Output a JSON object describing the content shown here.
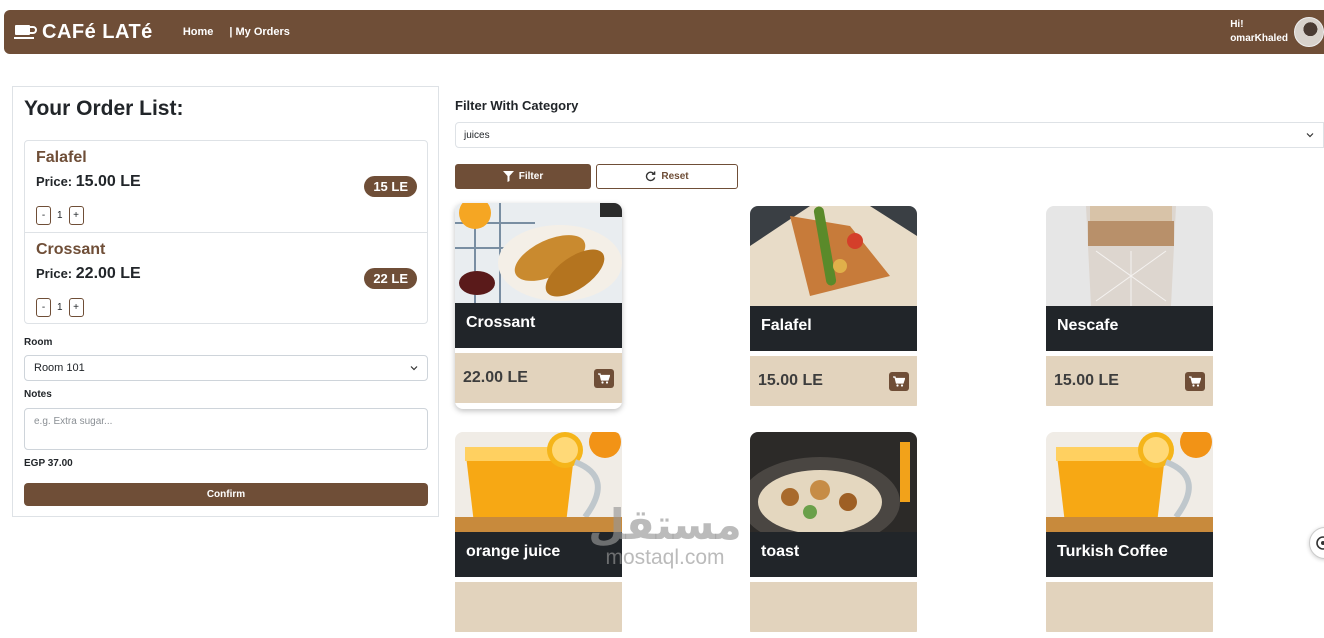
{
  "navbar": {
    "brand": "CAFé LATé",
    "links": [
      "Home",
      "| My Orders"
    ],
    "greeting": "Hi!",
    "username": "omarKhaled"
  },
  "order": {
    "title": "Your Order List:",
    "items": [
      {
        "name": "Falafel",
        "price_label": "Price:",
        "price": "15.00 LE",
        "badge": "15 LE",
        "qty": "1"
      },
      {
        "name": "Crossant",
        "price_label": "Price:",
        "price": "22.00 LE",
        "badge": "22 LE",
        "qty": "1"
      }
    ],
    "minus": "-",
    "plus": "+",
    "room_label": "Room",
    "room_value": "Room 101",
    "notes_label": "Notes",
    "notes_placeholder": "e.g. Extra sugar...",
    "total": "EGP 37.00",
    "confirm": "Confirm"
  },
  "filter": {
    "label": "Filter With Category",
    "category": "juices",
    "filter_btn": "Filter",
    "reset_btn": "Reset"
  },
  "products": [
    {
      "name": "Crossant",
      "price": "22.00 LE"
    },
    {
      "name": "Falafel",
      "price": "15.00 LE"
    },
    {
      "name": "Nescafe",
      "price": "15.00 LE"
    },
    {
      "name": "orange juice"
    },
    {
      "name": "toast"
    },
    {
      "name": "Turkish Coffee"
    }
  ],
  "watermark": {
    "arabic": "مستقل",
    "latin": "mostaql.com"
  },
  "colors": {
    "brand": "#6f4e37",
    "card_dark": "#212529",
    "card_foot": "#e2d3bd"
  }
}
